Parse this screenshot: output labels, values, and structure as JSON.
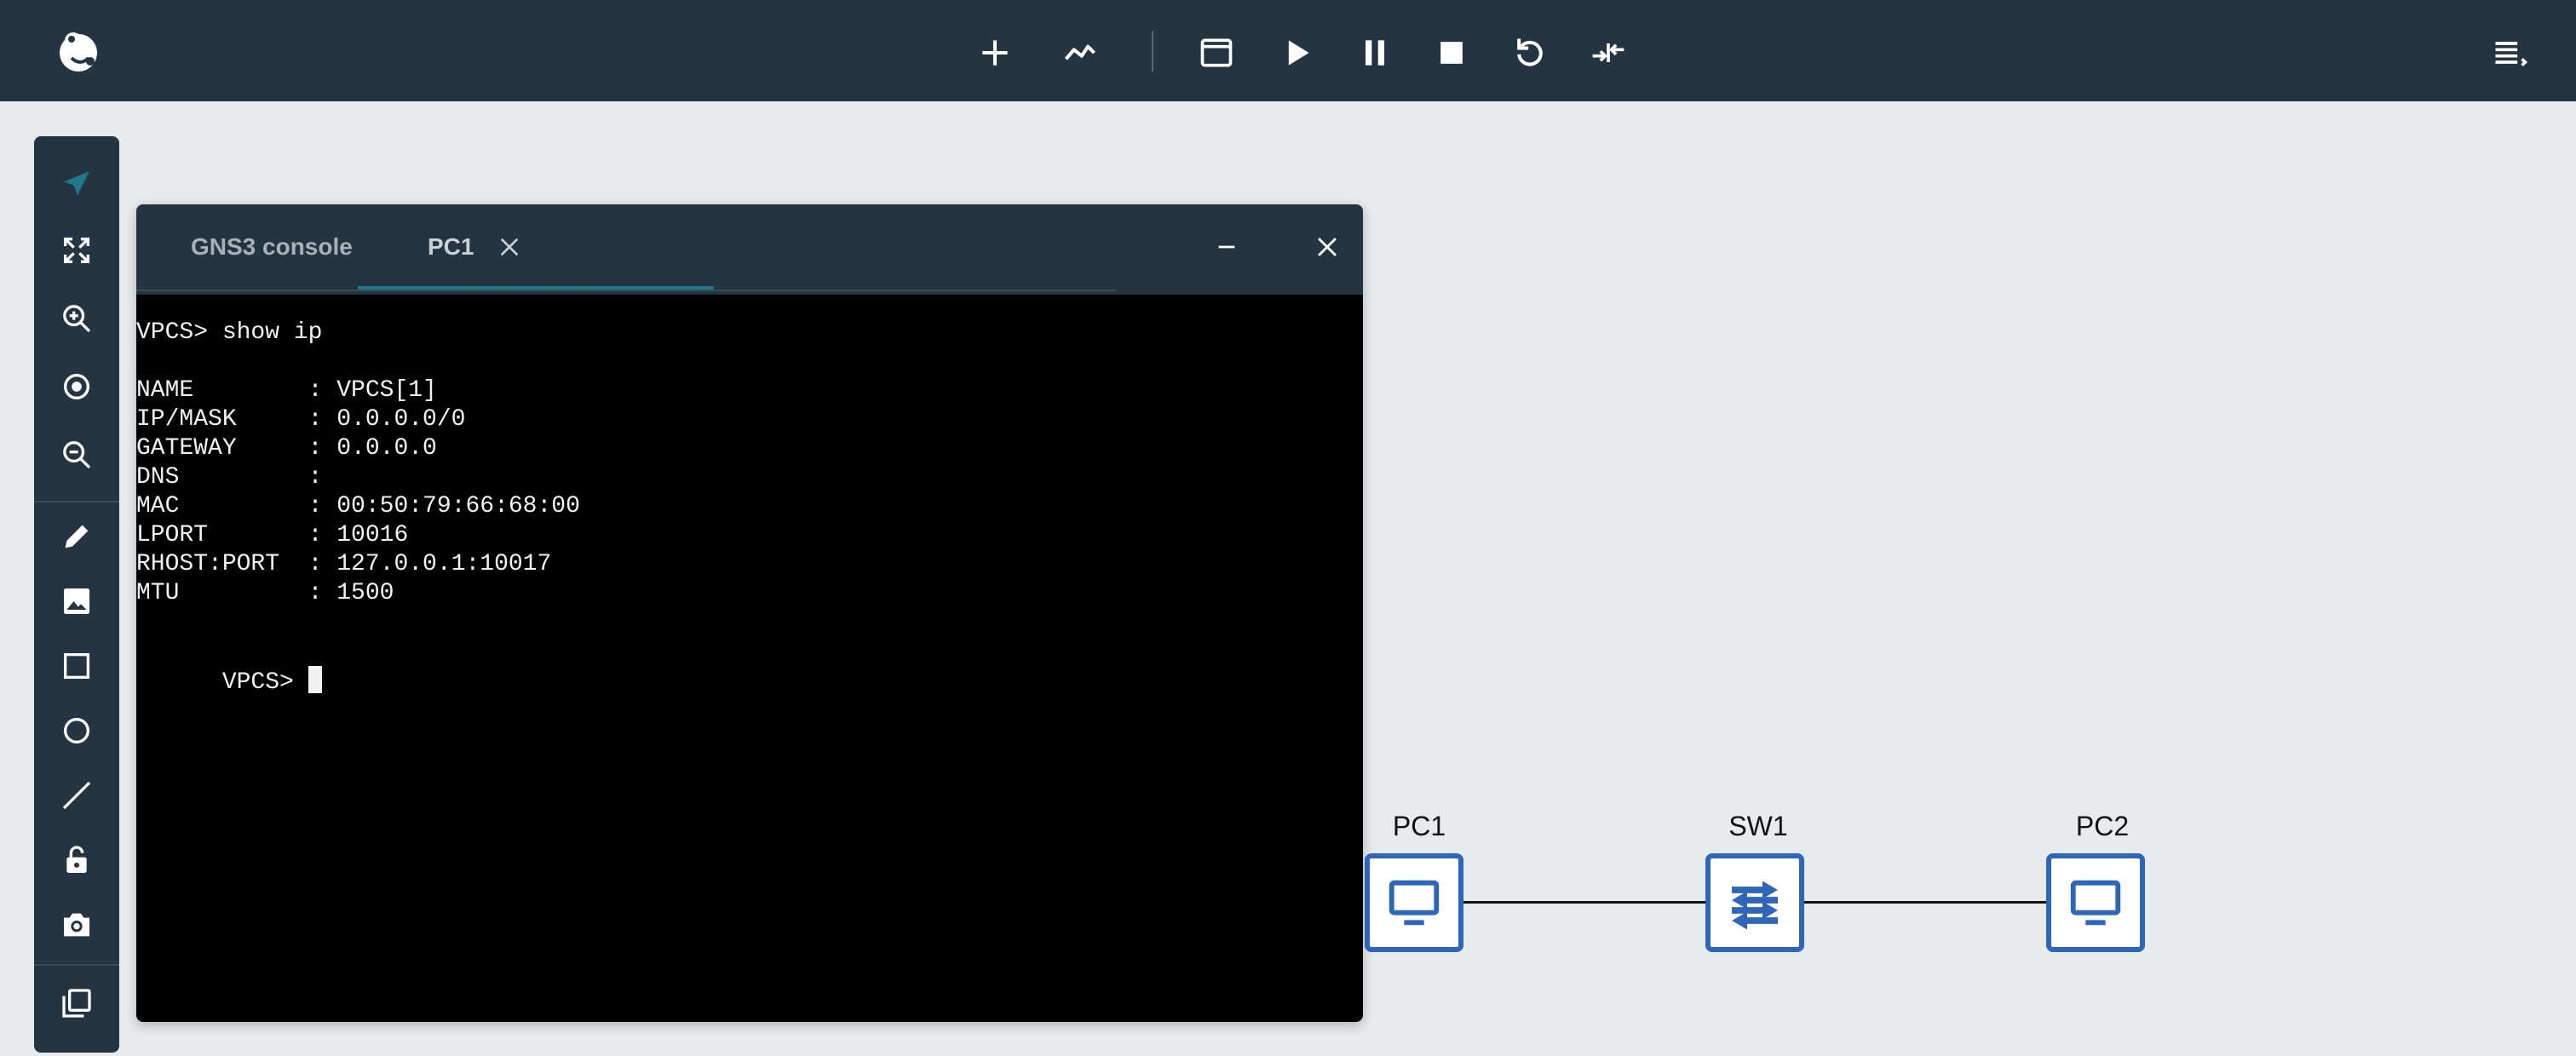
{
  "toolbar": {
    "icons": [
      "gns3-logo",
      "add-node-icon",
      "capture-icon",
      "console-icon",
      "start-icon",
      "pause-icon",
      "stop-icon",
      "reload-icon",
      "compress-icon",
      "menu-icon"
    ]
  },
  "console": {
    "tabs": [
      {
        "label": "GNS3 console",
        "active": false
      },
      {
        "label": "PC1",
        "active": true
      }
    ],
    "lines": [
      "VPCS> show ip",
      "",
      "NAME        : VPCS[1]",
      "IP/MASK     : 0.0.0.0/0",
      "GATEWAY     : 0.0.0.0",
      "DNS         :",
      "MAC         : 00:50:79:66:68:00",
      "LPORT       : 10016",
      "RHOST:PORT  : 127.0.0.1:10017",
      "MTU         : 1500",
      "",
      "VPCS> "
    ]
  },
  "topology": {
    "nodes": [
      {
        "name": "PC1",
        "type": "pc"
      },
      {
        "name": "SW1",
        "type": "switch"
      },
      {
        "name": "PC2",
        "type": "pc"
      }
    ]
  },
  "colors": {
    "accent": "#20768a",
    "node_border": "#2f66b8",
    "toolbar_bg": "#243441"
  }
}
